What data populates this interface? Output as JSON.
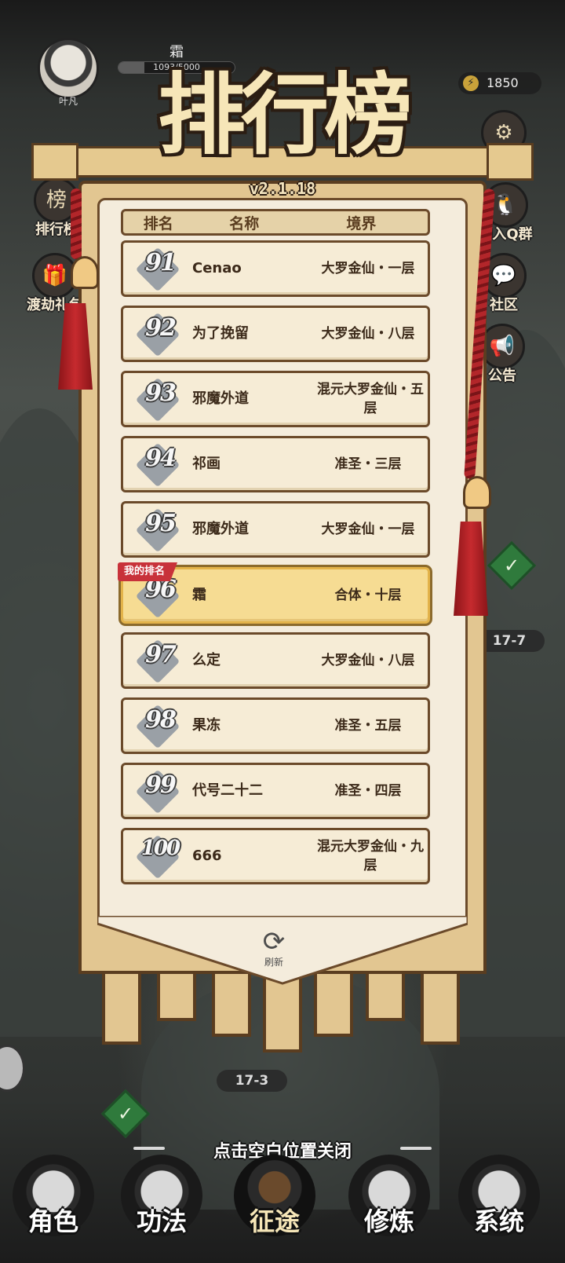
{
  "hud": {
    "avatar_name": "叶凡",
    "player_name": "霜",
    "exp_text": "1093/5000",
    "exp_fraction": 0.22,
    "energy_icon": "lightning-icon",
    "energy_value": "1850"
  },
  "side_left": [
    {
      "label": "排行榜",
      "icon": "ranking-icon",
      "glyph": "榜"
    },
    {
      "label": "渡劫礼包",
      "icon": "gift-icon",
      "glyph": "🎁"
    }
  ],
  "side_right": [
    {
      "label": "加入Q群",
      "icon": "penguin-icon",
      "glyph": "🐧"
    },
    {
      "label": "社区",
      "icon": "chat-icon",
      "glyph": "💬"
    },
    {
      "label": "公告",
      "icon": "speaker-icon",
      "glyph": "📢"
    }
  ],
  "map": {
    "stage_right": "17-7",
    "stage_bottom": "17-3"
  },
  "leaderboard": {
    "title": "排行榜",
    "version": "v2.1.18",
    "headers": {
      "rank": "排名",
      "name": "名称",
      "realm": "境界"
    },
    "my_rank_tag": "我的排名",
    "rows": [
      {
        "rank": "91",
        "name": "Cenao",
        "realm": "大罗金仙・一层"
      },
      {
        "rank": "92",
        "name": "为了挽留",
        "realm": "大罗金仙・八层"
      },
      {
        "rank": "93",
        "name": "邪魔外道",
        "realm": "混元大罗金仙・五层"
      },
      {
        "rank": "94",
        "name": "祁画",
        "realm": "准圣・三层"
      },
      {
        "rank": "95",
        "name": "邪魔外道",
        "realm": "大罗金仙・一层"
      },
      {
        "rank": "96",
        "name": "霜",
        "realm": "合体・十层",
        "is_me": true
      },
      {
        "rank": "97",
        "name": "么定",
        "realm": "大罗金仙・八层"
      },
      {
        "rank": "98",
        "name": "果冻",
        "realm": "准圣・五层"
      },
      {
        "rank": "99",
        "name": "代号二十二",
        "realm": "准圣・四层"
      },
      {
        "rank": "100",
        "name": "666",
        "realm": "混元大罗金仙・九层"
      }
    ],
    "refresh_label": "刷新",
    "refresh_icon": "refresh-icon"
  },
  "close_hint": "点击空白位置关闭",
  "nav": [
    {
      "label": "角色",
      "icon": "character-icon"
    },
    {
      "label": "功法",
      "icon": "scroll-book-icon"
    },
    {
      "label": "征途",
      "icon": "sword-icon",
      "active": true
    },
    {
      "label": "修炼",
      "icon": "meditation-icon"
    },
    {
      "label": "系统",
      "icon": "settings-girl-icon"
    }
  ],
  "colors": {
    "banner_gold": "#e2c691",
    "banner_border": "#5a3d20",
    "row_bg": "#f6ecd6",
    "my_row_bg": "#f6dc93",
    "my_rank_tag": "#c8323a",
    "tassel_red": "#b2262a"
  }
}
